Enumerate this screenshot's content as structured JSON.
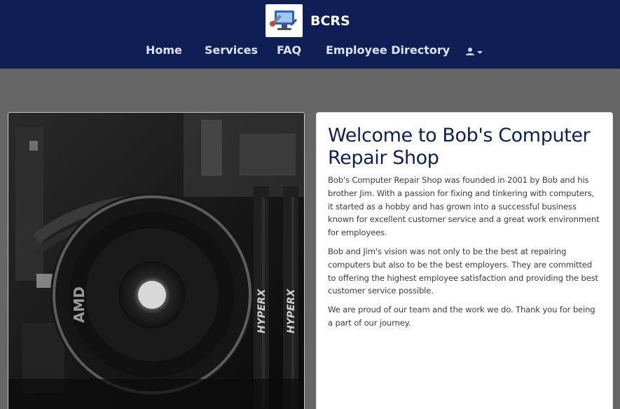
{
  "header": {
    "brand_name": "BCRS",
    "logo_icon": "computer-repair-logo-icon",
    "colors": {
      "navbar_bg": "#0f1f56",
      "page_bg": "#666666",
      "title": "#0f1f56"
    }
  },
  "nav": {
    "items": [
      {
        "label": "Home"
      },
      {
        "label": "Services"
      },
      {
        "label": "FAQ"
      },
      {
        "label": "Employee Directory"
      }
    ],
    "user_menu_icon": "user-icon",
    "dropdown_icon": "caret-down-icon"
  },
  "hero": {
    "image_icon": "pc-cooler-photo",
    "brand_marks": [
      "AMD",
      "HYPERX",
      "HYPERX"
    ]
  },
  "content": {
    "title": "Welcome to Bob's Computer Repair Shop",
    "paragraphs": [
      "Bob's Computer Repair Shop was founded in 2001 by Bob and his brother Jim. With a passion for fixing and tinkering with computers, it started as a hobby and has grown into a successful business known for excellent customer service and a great work environment for employees.",
      "Bob and Jim's vision was not only to be the best at repairing computers but also to be the best employers. They are committed to offering the highest employee satisfaction and providing the best customer service possible.",
      "We are proud of our team and the work we do. Thank you for being a part of our journey."
    ]
  }
}
